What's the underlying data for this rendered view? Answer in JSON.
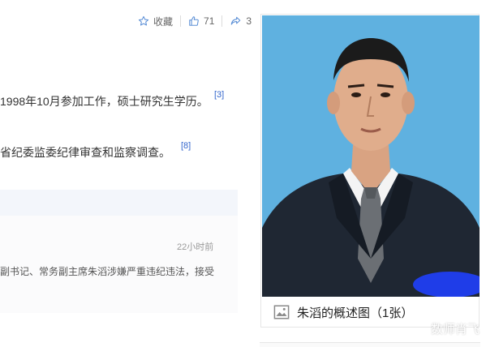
{
  "toolbar": {
    "collect_label": "收藏",
    "like_count": "71",
    "share_count": "3"
  },
  "summary": {
    "line1": "1998年10月参加工作，硕士研究生学历。",
    "line1_ref": "[3]",
    "line2": "省纪委监委纪律审查和监察调查。",
    "line2_ref": "[8]"
  },
  "news": {
    "time": "22小时前",
    "snippet": "副书记、常务副主席朱滔涉嫌严重违纪违法，接受"
  },
  "album": {
    "caption": "朱滔的概述图（1张）"
  },
  "watermark": "数师肖飞",
  "colors": {
    "accent": "#3366cc",
    "photo_bg": "#5fb1e0",
    "news_header_bg": "#f3f6fb"
  }
}
